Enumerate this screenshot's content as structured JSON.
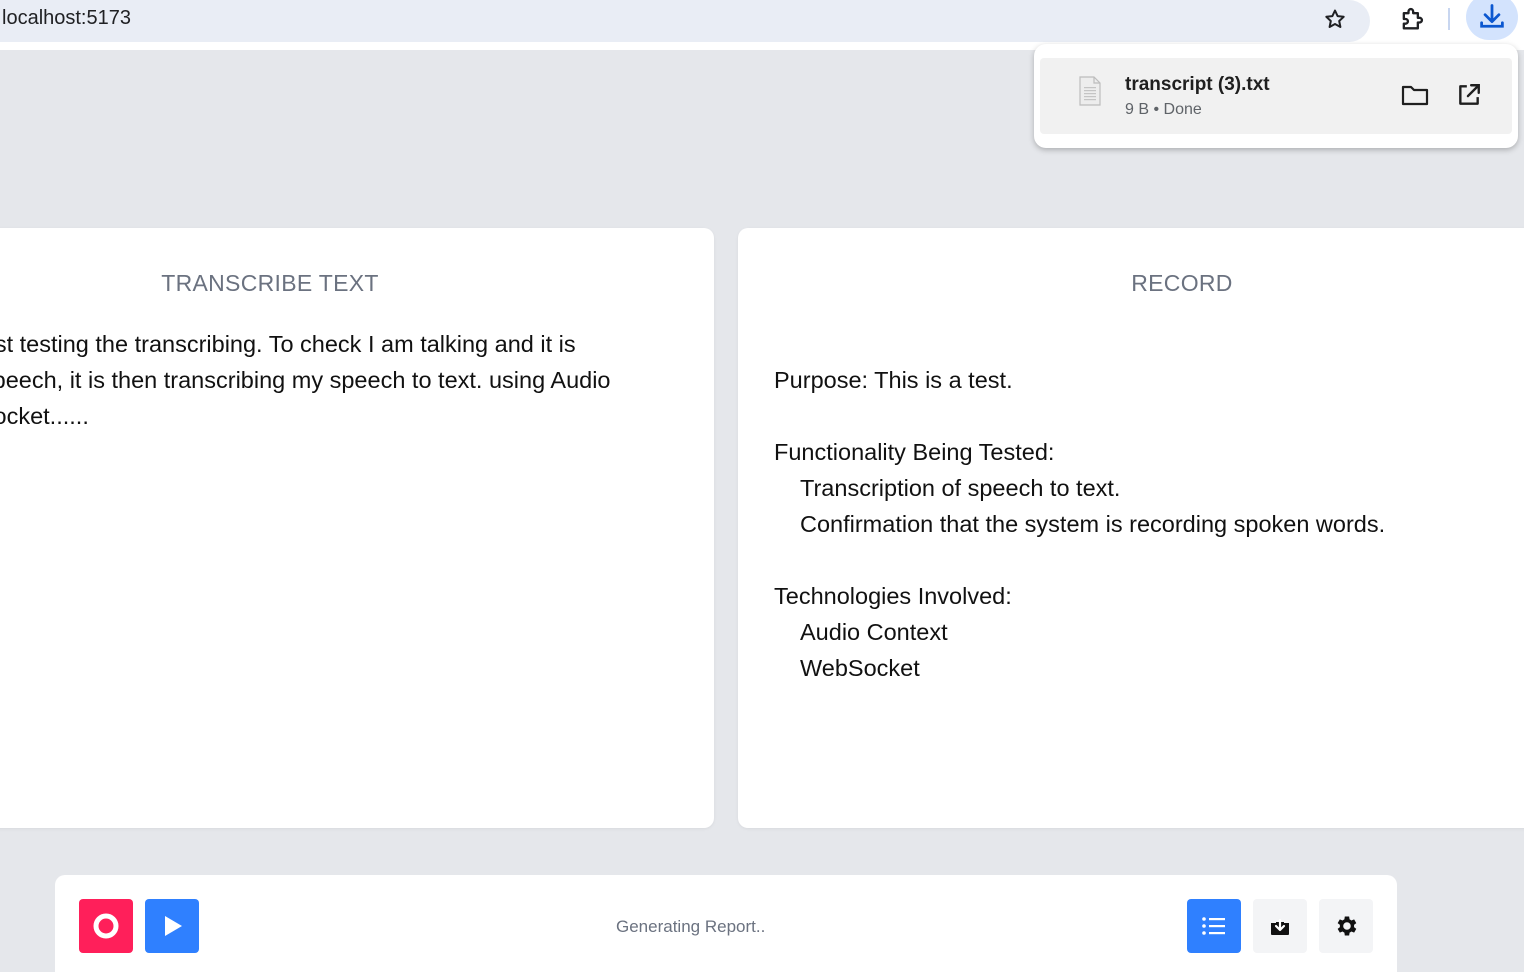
{
  "browser": {
    "url": "localhost:5173"
  },
  "download_popup": {
    "filename": "transcript (3).txt",
    "status": "9 B • Done"
  },
  "transcribe_panel": {
    "title": "TRANSCRIBE TEXT",
    "text": "Just testing the transcribing. To check I am talking and it is\n’ speech, it is then transcribing my speech to text. using Audio\n)Socket......"
  },
  "record_panel": {
    "title": "RECORD",
    "purpose": "Purpose: This is a test.",
    "functionality_heading": "Functionality Being Tested:",
    "functionality_items": [
      "Transcription of speech to text.",
      "Confirmation that the system is recording spoken words."
    ],
    "technologies_heading": "Technologies Involved:",
    "technologies_items": [
      "Audio Context",
      "WebSocket"
    ]
  },
  "control_bar": {
    "status": "Generating Report..",
    "buttons": [
      "record-icon",
      "play-icon",
      "list-icon",
      "download-icon",
      "gear-icon"
    ]
  },
  "colors": {
    "page_background": "#e5e7eb",
    "record_button": "#ff1f5a",
    "accent_blue": "#2f80ff",
    "neutral_button": "#f3f4f6",
    "title_gray": "#6b7280"
  }
}
